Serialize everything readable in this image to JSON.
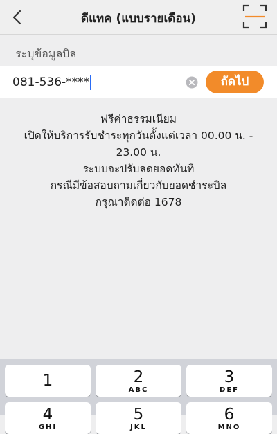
{
  "header": {
    "title": "ดีแทค (แบบรายเดือน)",
    "back_icon": "chevron-left-icon",
    "scan_icon": "scan-frame-icon",
    "accent_color": "#f28b2a"
  },
  "form": {
    "label": "ระบุข้อมูลบิล",
    "phone_value": "081-536-****",
    "next_button_label": "ถัดไป"
  },
  "notice": {
    "lines": [
      "ฟรีค่าธรรมเนียม",
      "เปิดให้บริการรับชำระทุกวันตั้งแต่เวลา 00.00 น. -",
      "23.00 น.",
      "ระบบจะปรับลดยอดทันที",
      "กรณีมีข้อสอบถามเกี่ยวกับยอดชำระบิล",
      "กรุณาติดต่อ 1678"
    ]
  },
  "keyboard": {
    "keys": [
      {
        "num": "1",
        "letters": ""
      },
      {
        "num": "2",
        "letters": "ABC"
      },
      {
        "num": "3",
        "letters": "DEF"
      },
      {
        "num": "4",
        "letters": "GHI"
      },
      {
        "num": "5",
        "letters": "JKL"
      },
      {
        "num": "6",
        "letters": "MNO"
      }
    ]
  }
}
